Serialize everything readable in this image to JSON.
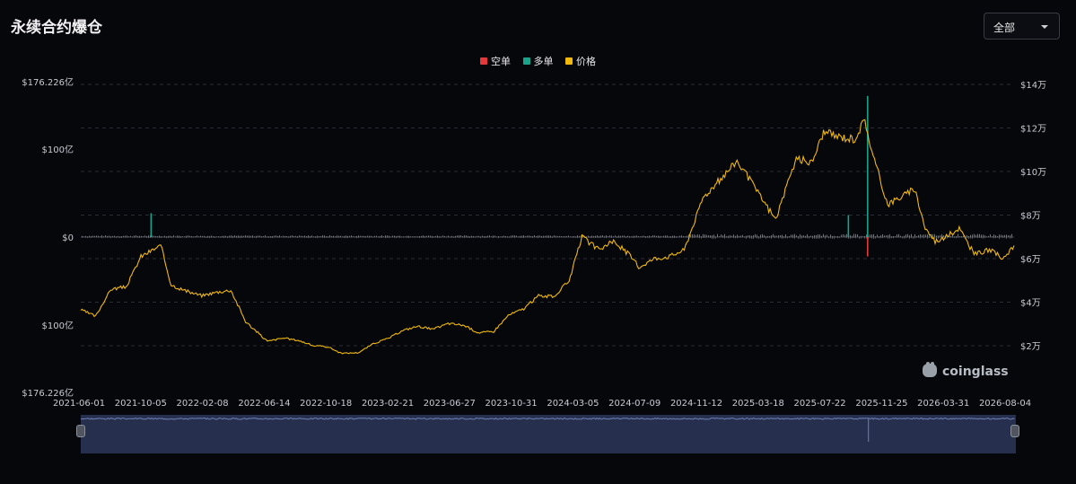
{
  "header": {
    "title": "永续合约爆仓"
  },
  "filter": {
    "selected": "全部"
  },
  "legend": [
    {
      "label": "空单",
      "color": "#e5383b"
    },
    {
      "label": "多单",
      "color": "#19a38a"
    },
    {
      "label": "价格",
      "color": "#f0b90b"
    }
  ],
  "chart_data": {
    "type": "bar+line",
    "left_axis": {
      "ticks": [
        "$176.226亿",
        "$100亿",
        "$0",
        "$100亿",
        "$176.226亿"
      ],
      "values": [
        176.226,
        100,
        0,
        -100,
        -176.226
      ],
      "ylim": [
        -176.226,
        176.226
      ]
    },
    "right_axis": {
      "ticks": [
        "$14万",
        "$12万",
        "$10万",
        "$8万",
        "$6万",
        "$4万",
        "$2万"
      ],
      "values": [
        140000,
        120000,
        100000,
        80000,
        60000,
        40000,
        20000
      ]
    },
    "x_ticks": [
      "2021-06-01",
      "2021-10-05",
      "2022-02-08",
      "2022-06-14",
      "2022-10-18",
      "2023-02-21",
      "2023-06-27",
      "2023-10-31",
      "2024-03-05",
      "2024-07-09",
      "2024-11-12",
      "2025-03-18",
      "2025-07-22",
      "2025-11-25",
      "2026-03-31",
      "2026-08-04"
    ],
    "price_series": {
      "name": "价格",
      "x": [
        "2021-06-01",
        "2021-07-01",
        "2021-08-01",
        "2021-09-01",
        "2021-10-01",
        "2021-11-10",
        "2021-12-01",
        "2022-01-01",
        "2022-02-01",
        "2022-03-01",
        "2022-04-01",
        "2022-05-01",
        "2022-06-14",
        "2022-07-15",
        "2022-08-15",
        "2022-09-15",
        "2022-10-15",
        "2022-11-10",
        "2022-12-15",
        "2023-01-15",
        "2023-02-15",
        "2023-03-15",
        "2023-04-15",
        "2023-05-15",
        "2023-06-15",
        "2023-07-15",
        "2023-08-15",
        "2023-09-15",
        "2023-10-15",
        "2023-11-15",
        "2023-12-15",
        "2024-01-15",
        "2024-02-15",
        "2024-03-12",
        "2024-04-15",
        "2024-05-15",
        "2024-06-15",
        "2024-07-05",
        "2024-08-05",
        "2024-09-05",
        "2024-10-05",
        "2024-11-12",
        "2024-12-15",
        "2025-01-20",
        "2025-02-20",
        "2025-04-08",
        "2025-05-20",
        "2025-06-20",
        "2025-07-14",
        "2025-08-14",
        "2025-09-15",
        "2025-10-06",
        "2025-10-20",
        "2025-11-21",
        "2025-12-15",
        "2026-01-15",
        "2026-02-05",
        "2026-02-25",
        "2026-03-20",
        "2026-04-15",
        "2026-05-15",
        "2026-06-15",
        "2026-07-15",
        "2026-08-04"
      ],
      "y": [
        36500,
        33500,
        46000,
        47000,
        61000,
        66000,
        48000,
        45000,
        43000,
        44500,
        45500,
        31000,
        22000,
        23500,
        22500,
        20000,
        19500,
        16500,
        16800,
        21000,
        23500,
        27000,
        29000,
        27500,
        30200,
        29500,
        26000,
        26500,
        34000,
        37000,
        43000,
        42500,
        50000,
        70000,
        64000,
        68000,
        62000,
        56000,
        60000,
        61000,
        64000,
        88000,
        96000,
        105000,
        94000,
        78000,
        106000,
        104000,
        118000,
        116000,
        115000,
        124000,
        109000,
        85000,
        88000,
        92000,
        74000,
        68000,
        70000,
        74000,
        62000,
        64000,
        60000,
        66000
      ]
    },
    "liquidation_series": [
      {
        "name": "多单",
        "spikes": [
          {
            "x": "2021-10-20",
            "value": 27
          },
          {
            "x": "2025-10-10",
            "value": 160
          },
          {
            "x": "2025-09-01",
            "value": 25
          }
        ]
      },
      {
        "name": "空单",
        "spikes": [
          {
            "x": "2025-10-10",
            "value": -22
          }
        ]
      }
    ]
  },
  "watermark": {
    "text": "coinglass"
  }
}
